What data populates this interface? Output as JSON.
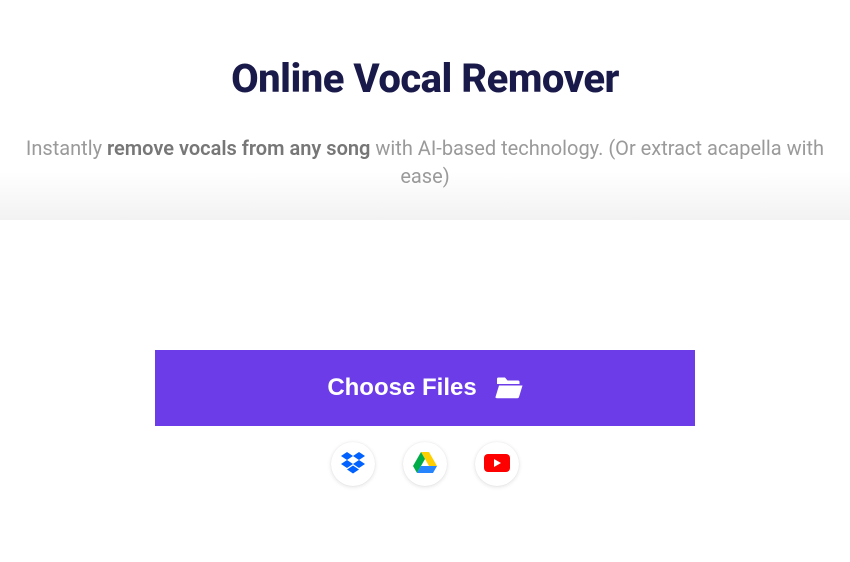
{
  "hero": {
    "title": "Online Vocal Remover",
    "subtitle_prefix": "Instantly ",
    "subtitle_bold": "remove vocals from any song",
    "subtitle_suffix": " with AI-based technology. (Or extract acapella with ease)"
  },
  "upload": {
    "button_label": "Choose Files"
  },
  "sources": {
    "dropbox": "Dropbox",
    "google_drive": "Google Drive",
    "youtube": "YouTube"
  },
  "colors": {
    "accent": "#6c3ce9",
    "title": "#1a1a4a"
  }
}
